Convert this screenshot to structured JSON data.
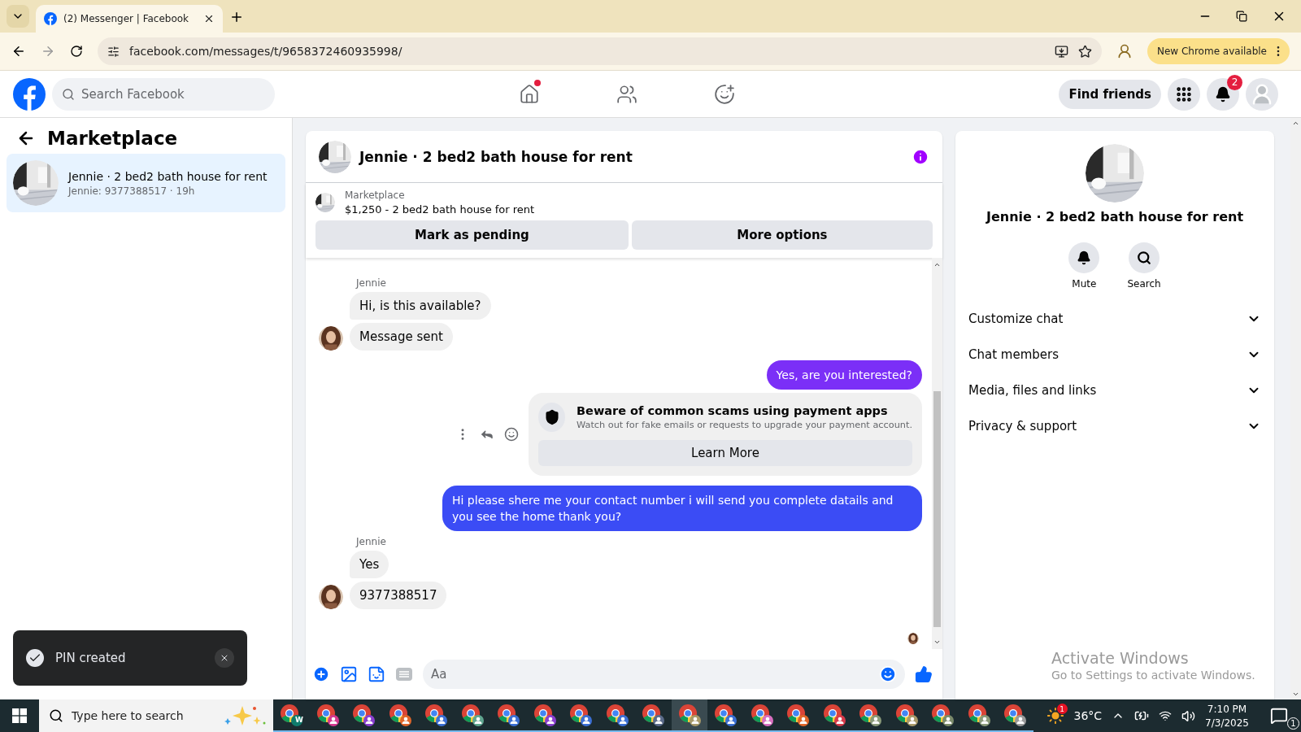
{
  "browser": {
    "tabs": [
      {
        "title": "(2) Messenger | Facebook",
        "selected": true
      }
    ],
    "url": "facebook.com/messages/t/9658372460935998/",
    "update_button": "New Chrome available"
  },
  "header": {
    "search": {
      "placeholder": "Search Facebook"
    },
    "nav": [
      {
        "kind": "home",
        "selected": false,
        "notify": true
      },
      {
        "kind": "friends",
        "selected": false,
        "notify": false
      },
      {
        "kind": "groups",
        "selected": false,
        "notify": false
      }
    ],
    "find_friends": "Find friends",
    "notification_count": "2"
  },
  "sidebar": {
    "title": "Marketplace",
    "conversations": [
      {
        "title": "Jennie · 2 bed2 bath house for rent",
        "subtitle": "Jennie: 9377388517 · 19h",
        "selected": true
      }
    ]
  },
  "chat": {
    "title": "Jennie · 2 bed2 bath house for rent",
    "listing": {
      "label": "Marketplace",
      "price_line": "$1,250 - 2 bed2 bath house for rent"
    },
    "buttons": [
      "Mark as pending",
      "More options"
    ],
    "messages": [
      {
        "kind": "sender",
        "text": "Jennie"
      },
      {
        "kind": "incoming",
        "text": "Hi, is this available?",
        "avatar": false
      },
      {
        "kind": "incoming",
        "text": "Message sent",
        "avatar": true
      },
      {
        "kind": "outgoing",
        "text": "Yes, are you interested?",
        "color": "#7b2ff7"
      },
      {
        "kind": "notice",
        "title": "Beware of common scams using payment apps",
        "body": "Watch out for fake emails or requests to upgrade your payment account.",
        "button": "Learn More"
      },
      {
        "kind": "outgoing",
        "text": "Hi please shere me your contact number i will send you complete datails and you see the home thank you?",
        "color": "#3b4cf5"
      },
      {
        "kind": "sender",
        "text": "Jennie"
      },
      {
        "kind": "incoming",
        "text": "Yes",
        "avatar": false
      },
      {
        "kind": "incoming",
        "text": "9377388517",
        "avatar": true
      }
    ],
    "composer": {
      "placeholder": "Aa"
    }
  },
  "details": {
    "title": "Jennie · 2 bed2 bath house for rent",
    "actions": [
      {
        "kind": "mute",
        "label": "Mute"
      },
      {
        "kind": "search",
        "label": "Search"
      }
    ],
    "sections": [
      {
        "label": "Customize chat",
        "expanded": false
      },
      {
        "label": "Chat members",
        "expanded": false
      },
      {
        "label": "Media, files and links",
        "expanded": false
      },
      {
        "label": "Privacy & support",
        "expanded": false
      }
    ]
  },
  "windows_notice": {
    "title": "Activate Windows",
    "body": "Go to Settings to activate Windows."
  },
  "toast": {
    "text": "PIN created"
  },
  "taskbar": {
    "search": {
      "placeholder": "Type here to search"
    },
    "apps": [
      {
        "color": "#0f7b6c",
        "badge": "W",
        "selected": false
      },
      {
        "color": "#d4388f",
        "selected": false
      },
      {
        "color": "#8a3fd0",
        "selected": false
      },
      {
        "color": "#e0662a",
        "selected": false
      },
      {
        "color": "#3b6fd4",
        "selected": false
      },
      {
        "color": "#5fa58f",
        "selected": false
      },
      {
        "color": "#3b6fd4",
        "selected": false
      },
      {
        "color": "#8a3fd0",
        "selected": false
      },
      {
        "color": "#3b6fd4",
        "selected": false
      },
      {
        "color": "#3b6fd4",
        "selected": false
      },
      {
        "color": "#5b6b8a",
        "selected": false
      },
      {
        "color": "#a89a6a",
        "selected": true
      },
      {
        "color": "#3b6fd4",
        "selected": false
      },
      {
        "color": "#d86fc0",
        "selected": false
      },
      {
        "color": "#e0662a",
        "selected": false
      },
      {
        "color": "#d83a4a",
        "selected": false
      },
      {
        "color": "#8a9a7a",
        "selected": false
      },
      {
        "color": "#a89a6a",
        "selected": false
      },
      {
        "color": "#7a8a6a",
        "selected": false
      },
      {
        "color": "#8a9a7a",
        "selected": false
      },
      {
        "color": "#9a9a9a",
        "selected": false
      }
    ],
    "weather": {
      "temperature": "36°C",
      "alert": "1"
    },
    "time": "7:10 PM",
    "date": "7/3/2025",
    "notifications": "1"
  }
}
